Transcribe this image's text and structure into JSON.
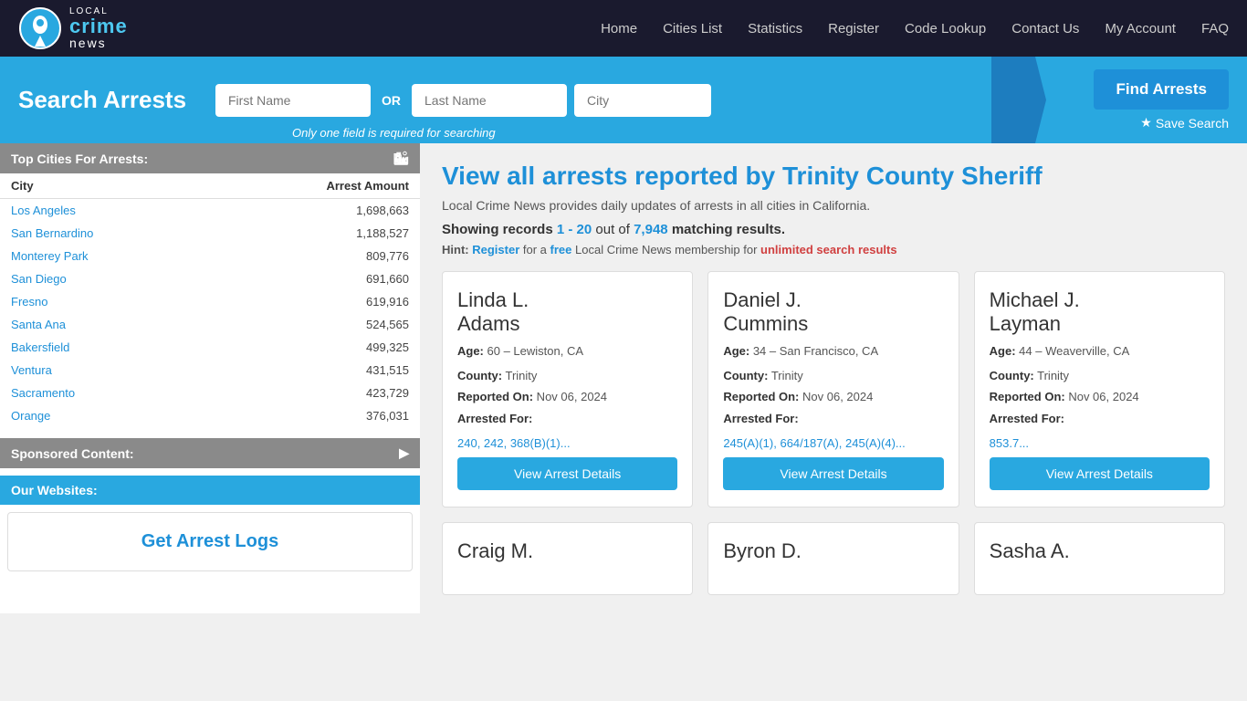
{
  "nav": {
    "links": [
      "Home",
      "Cities List",
      "Statistics",
      "Register",
      "Code Lookup",
      "Contact Us",
      "My Account",
      "FAQ"
    ]
  },
  "search": {
    "title": "Search Arrests",
    "first_name_placeholder": "First Name",
    "last_name_placeholder": "Last Name",
    "city_placeholder": "City",
    "or_label": "OR",
    "hint": "Only one field is required for searching",
    "find_btn": "Find Arrests",
    "save_btn": "Save Search"
  },
  "sidebar": {
    "top_cities_header": "Top Cities For Arrests:",
    "columns": {
      "city": "City",
      "arrest_amount": "Arrest Amount"
    },
    "cities": [
      {
        "name": "Los Angeles",
        "count": "1,698,663"
      },
      {
        "name": "San Bernardino",
        "count": "1,188,527"
      },
      {
        "name": "Monterey Park",
        "count": "809,776"
      },
      {
        "name": "San Diego",
        "count": "691,660"
      },
      {
        "name": "Fresno",
        "count": "619,916"
      },
      {
        "name": "Santa Ana",
        "count": "524,565"
      },
      {
        "name": "Bakersfield",
        "count": "499,325"
      },
      {
        "name": "Ventura",
        "count": "431,515"
      },
      {
        "name": "Sacramento",
        "count": "423,729"
      },
      {
        "name": "Orange",
        "count": "376,031"
      }
    ],
    "sponsored_header": "Sponsored Content:",
    "our_websites_header": "Our Websites:",
    "get_arrest_logs": "Get Arrest Logs"
  },
  "content": {
    "page_title": "View all arrests reported by Trinity County Sheriff",
    "subtitle": "Local Crime News provides daily updates of arrests in all cities in California.",
    "showing_label": "Showing records",
    "range": "1 - 20",
    "out_of": "out of",
    "total": "7,948",
    "matching": "matching results.",
    "hint_prefix": "Hint:",
    "hint_register": "Register",
    "hint_for": "for a",
    "hint_free": "free",
    "hint_membership": "Local Crime News membership for",
    "hint_unlimited": "unlimited search results",
    "cards": [
      {
        "name": "Linda L.\nAdams",
        "age_label": "Age:",
        "age": "60",
        "location": "Lewiston, CA",
        "county_label": "County:",
        "county": "Trinity",
        "reported_label": "Reported On:",
        "reported": "Nov 06, 2024",
        "arrested_label": "Arrested For:",
        "charges": "240, 242, 368(B)(1)...",
        "btn": "View Arrest Details"
      },
      {
        "name": "Daniel J.\nCummins",
        "age_label": "Age:",
        "age": "34",
        "location": "San Francisco, CA",
        "county_label": "County:",
        "county": "Trinity",
        "reported_label": "Reported On:",
        "reported": "Nov 06, 2024",
        "arrested_label": "Arrested For:",
        "charges": "245(A)(1), 664/187(A), 245(A)(4)...",
        "btn": "View Arrest Details"
      },
      {
        "name": "Michael J.\nLayman",
        "age_label": "Age:",
        "age": "44",
        "location": "Weaverville, CA",
        "county_label": "County:",
        "county": "Trinity",
        "reported_label": "Reported On:",
        "reported": "Nov 06, 2024",
        "arrested_label": "Arrested For:",
        "charges": "853.7...",
        "btn": "View Arrest Details"
      }
    ],
    "partial_cards": [
      {
        "name": "Craig M."
      },
      {
        "name": "Byron D."
      },
      {
        "name": "Sasha A."
      }
    ]
  }
}
